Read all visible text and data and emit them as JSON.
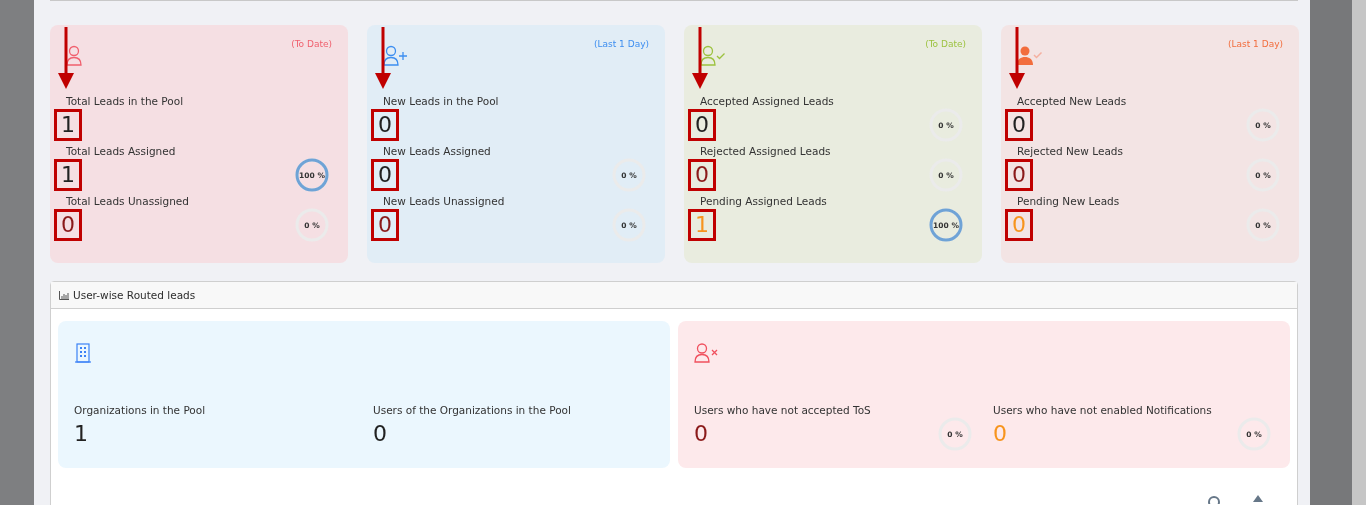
{
  "cards": [
    {
      "period": "(To Date)",
      "metrics": [
        {
          "label": "Total Leads in the Pool",
          "value": "1",
          "kind": "normal",
          "highlighted": true
        },
        {
          "label": "Total Leads Assigned",
          "value": "1",
          "kind": "normal",
          "highlighted": true,
          "percent": "100 %",
          "level": 1
        },
        {
          "label": "Total Leads Unassigned",
          "value": "0",
          "kind": "negative",
          "highlighted": true,
          "percent": "0 %",
          "level": 0
        }
      ]
    },
    {
      "period": "(Last 1 Day)",
      "metrics": [
        {
          "label": "New Leads in the Pool",
          "value": "0",
          "kind": "normal",
          "highlighted": true
        },
        {
          "label": "New Leads Assigned",
          "value": "0",
          "kind": "normal",
          "highlighted": true,
          "percent": "0 %",
          "level": 0
        },
        {
          "label": "New Leads Unassigned",
          "value": "0",
          "kind": "negative",
          "highlighted": true,
          "percent": "0 %",
          "level": 0
        }
      ]
    },
    {
      "period": "(To Date)",
      "metrics": [
        {
          "label": "Accepted Assigned Leads",
          "value": "0",
          "kind": "normal",
          "highlighted": true,
          "percent": "0 %",
          "level": 0
        },
        {
          "label": "Rejected Assigned Leads",
          "value": "0",
          "kind": "negative",
          "highlighted": true,
          "percent": "0 %",
          "level": 0
        },
        {
          "label": "Pending Assigned Leads",
          "value": "1",
          "kind": "pending",
          "highlighted": true,
          "percent": "100 %",
          "level": 1
        }
      ]
    },
    {
      "period": "(Last 1 Day)",
      "metrics": [
        {
          "label": "Accepted New Leads",
          "value": "0",
          "kind": "normal",
          "highlighted": true,
          "percent": "0 %",
          "level": 0
        },
        {
          "label": "Rejected New Leads",
          "value": "0",
          "kind": "negative",
          "highlighted": true,
          "percent": "0 %",
          "level": 0
        },
        {
          "label": "Pending New Leads",
          "value": "0",
          "kind": "pending",
          "highlighted": true,
          "percent": "0 %",
          "level": 0
        }
      ]
    }
  ],
  "routed": {
    "title": "User-wise Routed leads",
    "tiles": [
      {
        "kind": "info",
        "items": [
          {
            "label": "Organizations in the Pool",
            "value": "1",
            "kind": "normal"
          },
          {
            "label": "Users of the Organizations in the Pool",
            "value": "0",
            "kind": "normal"
          }
        ]
      },
      {
        "kind": "alert",
        "items": [
          {
            "label": "Users who have not accepted ToS",
            "value": "0",
            "kind": "negative",
            "percent": "0 %",
            "level": 0
          },
          {
            "label": "Users who have not enabled Notifications",
            "value": "0",
            "kind": "pending",
            "percent": "0 %",
            "level": 0
          }
        ]
      }
    ]
  }
}
